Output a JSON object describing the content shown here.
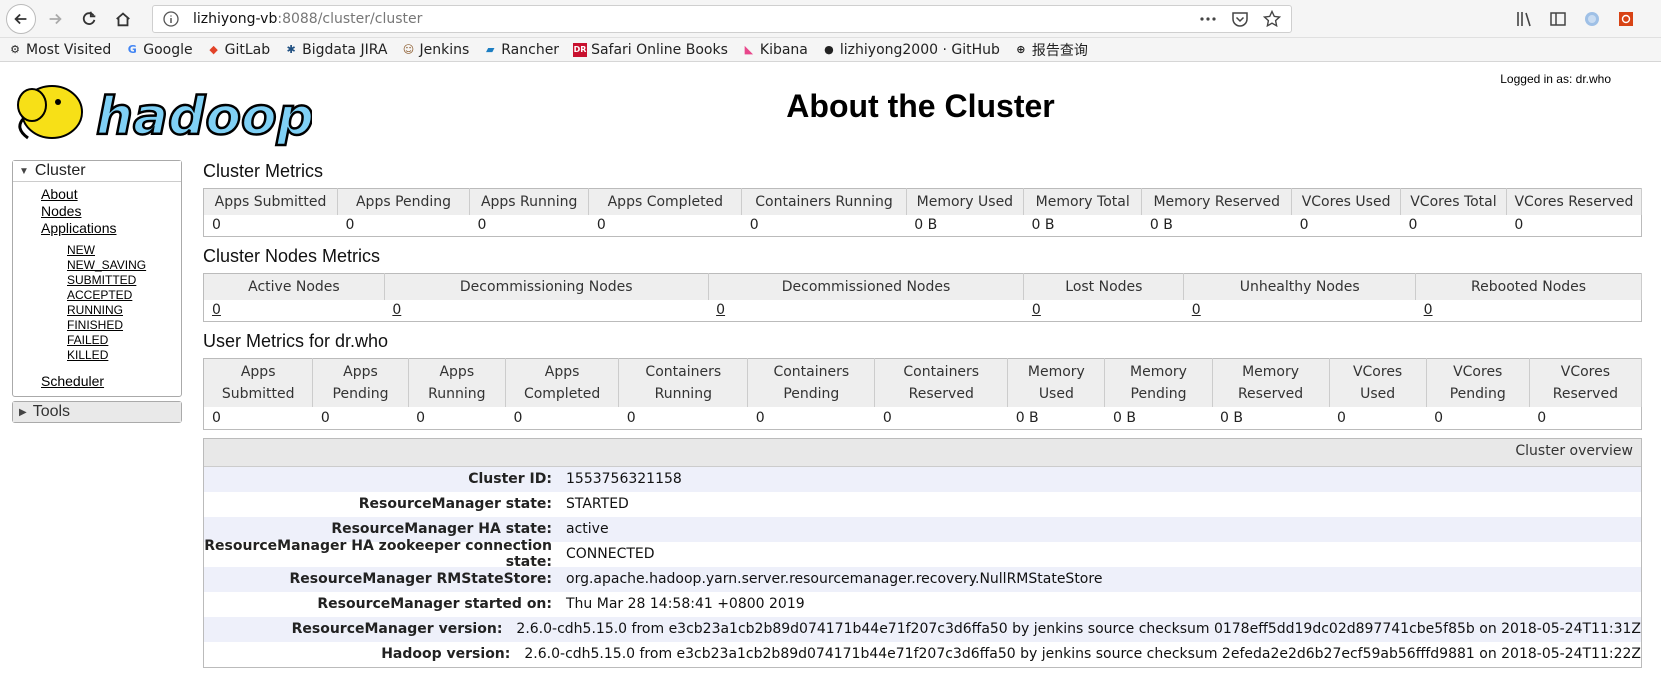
{
  "browser": {
    "url_host": "lizhiyong-vb",
    "url_rest": ":8088/cluster/cluster",
    "bookmarks": [
      "Most Visited",
      "Google",
      "GitLab",
      "Bigdata JIRA",
      "Jenkins",
      "Rancher",
      "Safari Online Books",
      "Kibana",
      "lizhiyong2000 · GitHub",
      "报告查询"
    ]
  },
  "header": {
    "title": "About the Cluster",
    "logged_in": "Logged in as: dr.who",
    "logo_text": "hadoop"
  },
  "nav": {
    "cluster_label": "Cluster",
    "about": "About",
    "nodes": "Nodes",
    "applications": "Applications",
    "app_states": [
      "NEW",
      "NEW_SAVING",
      "SUBMITTED",
      "ACCEPTED",
      "RUNNING",
      "FINISHED",
      "FAILED",
      "KILLED"
    ],
    "scheduler": "Scheduler",
    "tools_label": "Tools"
  },
  "cluster_metrics": {
    "title": "Cluster Metrics",
    "headers": [
      "Apps Submitted",
      "Apps Pending",
      "Apps Running",
      "Apps Completed",
      "Containers Running",
      "Memory Used",
      "Memory Total",
      "Memory Reserved",
      "VCores Used",
      "VCores Total",
      "VCores Reserved"
    ],
    "values": [
      "0",
      "0",
      "0",
      "0",
      "0",
      "0 B",
      "0 B",
      "0 B",
      "0",
      "0",
      "0"
    ]
  },
  "node_metrics": {
    "title": "Cluster Nodes Metrics",
    "headers": [
      "Active Nodes",
      "Decommissioning Nodes",
      "Decommissioned Nodes",
      "Lost Nodes",
      "Unhealthy Nodes",
      "Rebooted Nodes"
    ],
    "values": [
      "0",
      "0",
      "0",
      "0",
      "0",
      "0"
    ]
  },
  "user_metrics": {
    "title": "User Metrics for dr.who",
    "headers": [
      [
        "Apps",
        "Submitted"
      ],
      [
        "Apps",
        "Pending"
      ],
      [
        "Apps",
        "Running"
      ],
      [
        "Apps",
        "Completed"
      ],
      [
        "Containers",
        "Running"
      ],
      [
        "Containers",
        "Pending"
      ],
      [
        "Containers",
        "Reserved"
      ],
      [
        "Memory",
        "Used"
      ],
      [
        "Memory",
        "Pending"
      ],
      [
        "Memory",
        "Reserved"
      ],
      [
        "VCores",
        "Used"
      ],
      [
        "VCores",
        "Pending"
      ],
      [
        "VCores",
        "Reserved"
      ]
    ],
    "values": [
      "0",
      "0",
      "0",
      "0",
      "0",
      "0",
      "0",
      "0 B",
      "0 B",
      "0 B",
      "0",
      "0",
      "0"
    ]
  },
  "overview": {
    "title": "Cluster overview",
    "rows": [
      {
        "key": "Cluster ID:",
        "value": "1553756321158"
      },
      {
        "key": "ResourceManager state:",
        "value": "STARTED"
      },
      {
        "key": "ResourceManager HA state:",
        "value": "active"
      },
      {
        "key": "ResourceManager HA zookeeper connection state:",
        "value": "CONNECTED"
      },
      {
        "key": "ResourceManager RMStateStore:",
        "value": "org.apache.hadoop.yarn.server.resourcemanager.recovery.NullRMStateStore"
      },
      {
        "key": "ResourceManager started on:",
        "value": "Thu Mar 28 14:58:41 +0800 2019"
      },
      {
        "key": "ResourceManager version:",
        "value": "2.6.0-cdh5.15.0 from e3cb23a1cb2b89d074171b44e71f207c3d6ffa50 by jenkins source checksum 0178eff5dd19dc02d897741cbe5f85b on 2018-05-24T11:31Z"
      },
      {
        "key": "Hadoop version:",
        "value": "2.6.0-cdh5.15.0 from e3cb23a1cb2b89d074171b44e71f207c3d6ffa50 by jenkins source checksum 2efeda2e2d6b27ecf59ab56fffd9881 on 2018-05-24T11:22Z"
      }
    ]
  }
}
